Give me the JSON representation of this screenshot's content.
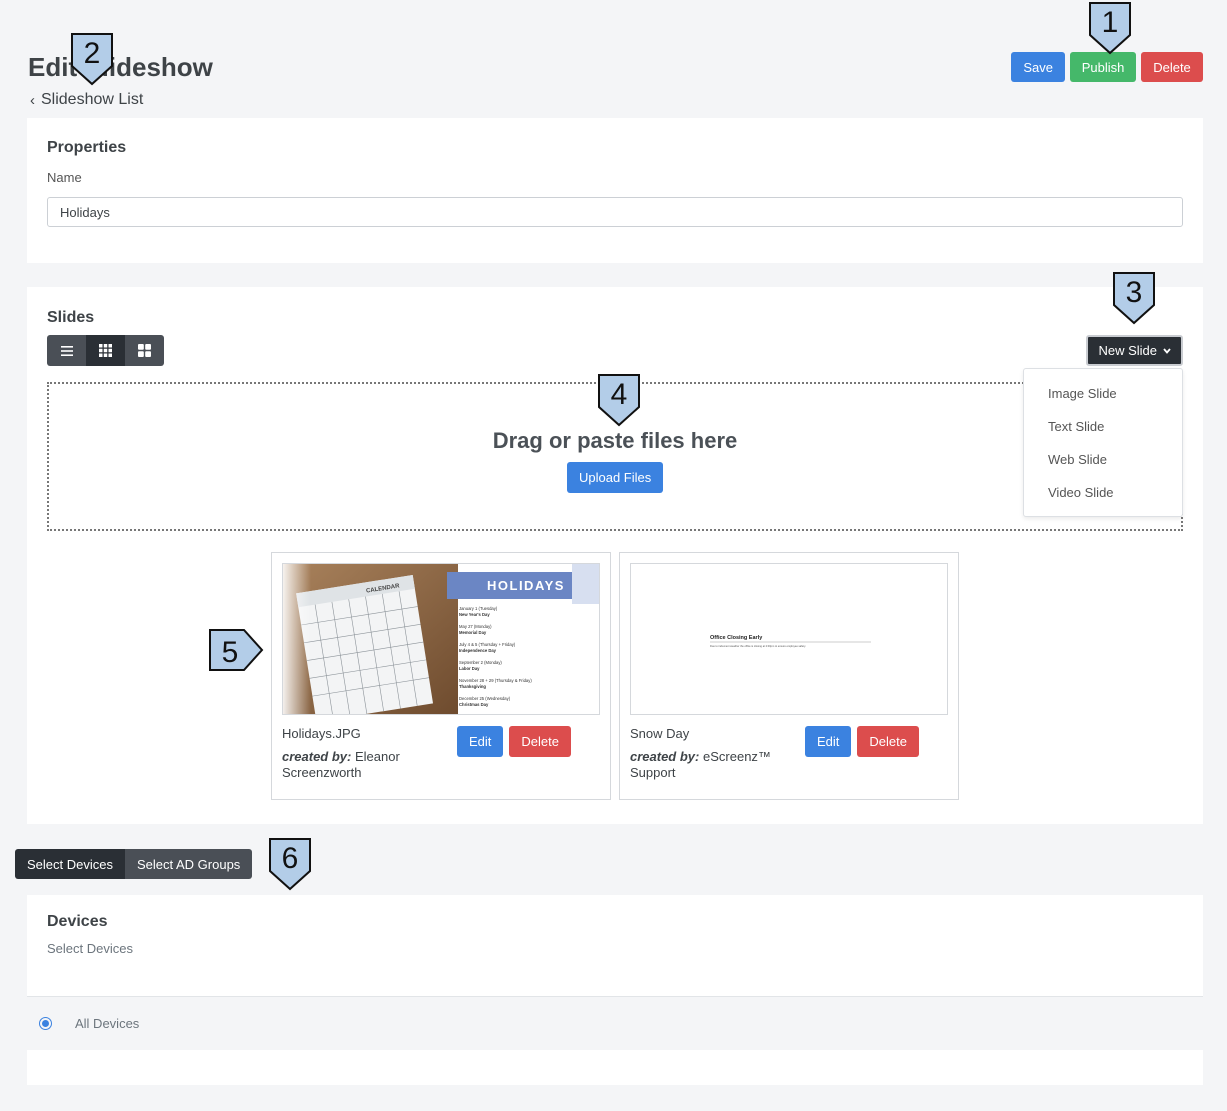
{
  "header": {
    "title": "Edit Slideshow",
    "back_label": "Slideshow List",
    "save_label": "Save",
    "publish_label": "Publish",
    "delete_label": "Delete"
  },
  "properties": {
    "heading": "Properties",
    "name_label": "Name",
    "name_value": "Holidays"
  },
  "slides": {
    "heading": "Slides",
    "new_slide_label": "New Slide",
    "menu": [
      "Image Slide",
      "Text Slide",
      "Web Slide",
      "Video Slide"
    ],
    "drop_text": "Drag or paste files here",
    "upload_label": "Upload Files",
    "items": [
      {
        "name": "Holidays.JPG",
        "created_by_label": "created by:",
        "creator": "Eleanor Screenzworth",
        "edit_label": "Edit",
        "delete_label": "Delete",
        "thumb": {
          "banner": "HOLIDAYS",
          "calendar_header": "CALENDAR",
          "lines": [
            "January 1 (Tuesday)",
            "New Year's Day",
            "May 27 (Monday)",
            "Memorial Day",
            "July 4 & 5 (Thursday + Friday)",
            "Independence Day",
            "September 2 (Monday)",
            "Labor Day",
            "November 28 + 29 (Thursday & Friday)",
            "Thanksgiving",
            "December 25 (Wednesday)",
            "Christmas Day"
          ]
        }
      },
      {
        "name": "Snow Day",
        "created_by_label": "created by:",
        "creator": "eScreenz™ Support",
        "edit_label": "Edit",
        "delete_label": "Delete",
        "thumb": {
          "title": "Office Closing Early",
          "body": "Due to inclement weather the office is closing at 2:00pm to ensure employee safety."
        }
      }
    ]
  },
  "targets": {
    "devices_tab": "Select Devices",
    "groups_tab": "Select AD Groups"
  },
  "devices": {
    "heading": "Devices",
    "sub": "Select Devices",
    "option": "All Devices"
  },
  "callouts": [
    "1",
    "2",
    "3",
    "4",
    "5",
    "6"
  ],
  "colors": {
    "primary": "#3b82e0",
    "success": "#45b86a",
    "danger": "#dc4d4d",
    "dark": "#2a2f35",
    "callout_fill": "#b3cde8"
  }
}
